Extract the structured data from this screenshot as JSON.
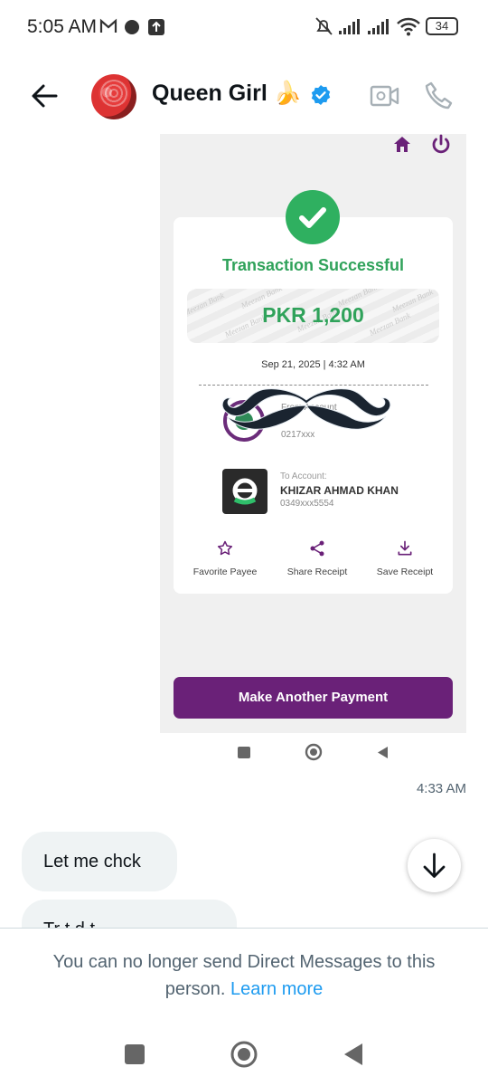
{
  "status_bar": {
    "time": "5:05 AM",
    "icons": [
      "gmail-icon",
      "notification-dot-icon",
      "upload-icon",
      "bell-muted-icon",
      "signal-icon",
      "signal-icon",
      "wifi-icon",
      "battery-icon"
    ],
    "battery": "34"
  },
  "header": {
    "name": "Queen Girl 🍌",
    "verified": true,
    "accent": "#1d9bf0"
  },
  "receipt": {
    "status": "Transaction Successful",
    "amount": "PKR 1,200",
    "watermark": "Meezan Bank",
    "date": "Sep 21, 2025 | 4:32 AM",
    "from_label": "From Account",
    "from_account": "0217xxx",
    "to_label": "To Account:",
    "to_name": "KHIZAR AHMAD KHAN",
    "to_account": "0349xxx5554",
    "actions": [
      "Favorite Payee",
      "Share Receipt",
      "Save Receipt"
    ],
    "pay_button": "Make Another Payment",
    "brand_color": "#6a2178",
    "success_color": "#2fa25a"
  },
  "message_time": "4:33 AM",
  "messages": [
    {
      "text": "Let me chck"
    },
    {
      "text": "Tr t   d  t"
    }
  ],
  "blocked_notice": {
    "text": "You can no longer send Direct Messages to this person.",
    "link": "Learn more"
  }
}
